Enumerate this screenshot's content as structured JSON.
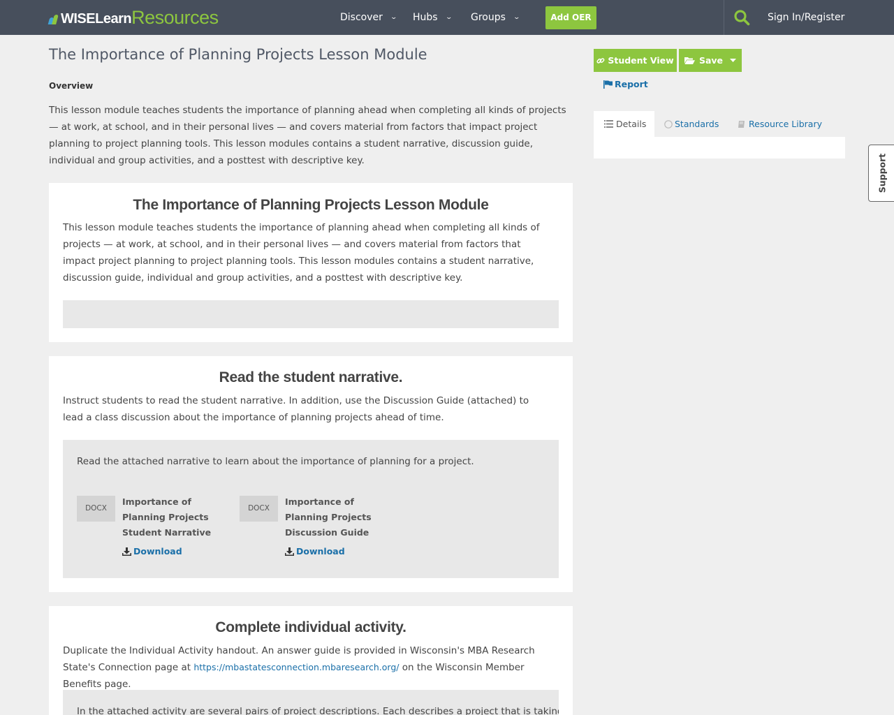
{
  "header": {
    "logo_wise": "WISELearn",
    "logo_resources": "Resources",
    "nav": [
      {
        "label": "Discover"
      },
      {
        "label": "Hubs"
      },
      {
        "label": "Groups"
      }
    ],
    "add_oer": "Add OER",
    "sign_in": "Sign In/Register"
  },
  "main": {
    "title": "The Importance of Planning Projects Lesson Module",
    "overview_label": "Overview",
    "overview_text": "This lesson module teaches students the importance of planning ahead when completing all kinds of projects — at work, at school, and in their personal lives — and covers material from factors that impact project planning to project planning tools. This lesson modules contains a student narrative, discussion guide, individual and group activities, and a posttest with descriptive key.",
    "sections": [
      {
        "heading": "The Importance of Planning Projects Lesson Module",
        "text": "This lesson module teaches students the importance of planning ahead when completing all kinds of projects — at work, at school, and in their personal lives — and covers material from factors that impact project planning to project planning tools. This lesson modules contains a student narrative, discussion guide, individual and group activities, and a posttest with descriptive key."
      },
      {
        "heading": "Read the student narrative.",
        "text": "Instruct students to read the student narrative. In addition, use the Discussion Guide (attached) to lead a class discussion about the importance of planning projects ahead of time.",
        "inner_text": "Read the attached narrative to learn about the importance of planning for a project.",
        "files": [
          {
            "type": "DOCX",
            "name": "Importance of Planning Projects Student Narrative",
            "download": "Download"
          },
          {
            "type": "DOCX",
            "name": "Importance of Planning Projects Discussion Guide",
            "download": "Download"
          }
        ]
      },
      {
        "heading": "Complete individual activity.",
        "text_before": "Duplicate the Individual Activity handout. An answer guide is provided in Wisconsin's MBA Research State's Connection page at",
        "link": "https://mbastatesconnection.mbaresearch.org/",
        "text_after": "on the Wisconsin Member Benefits page.",
        "inner_text": "In the attached activity are several pairs of project descriptions. Each describes a project that is taking"
      }
    ]
  },
  "sidebar": {
    "student_view": "Student View",
    "save": "Save",
    "report": "Report",
    "tabs": [
      {
        "label": "Details"
      },
      {
        "label": "Standards"
      },
      {
        "label": "Resource Library"
      }
    ]
  },
  "support": "Support",
  "colors": {
    "topbar": "#474f5c",
    "accent_green": "#8dc63f",
    "link_blue": "#1a6fa8",
    "background": "#efefef"
  }
}
